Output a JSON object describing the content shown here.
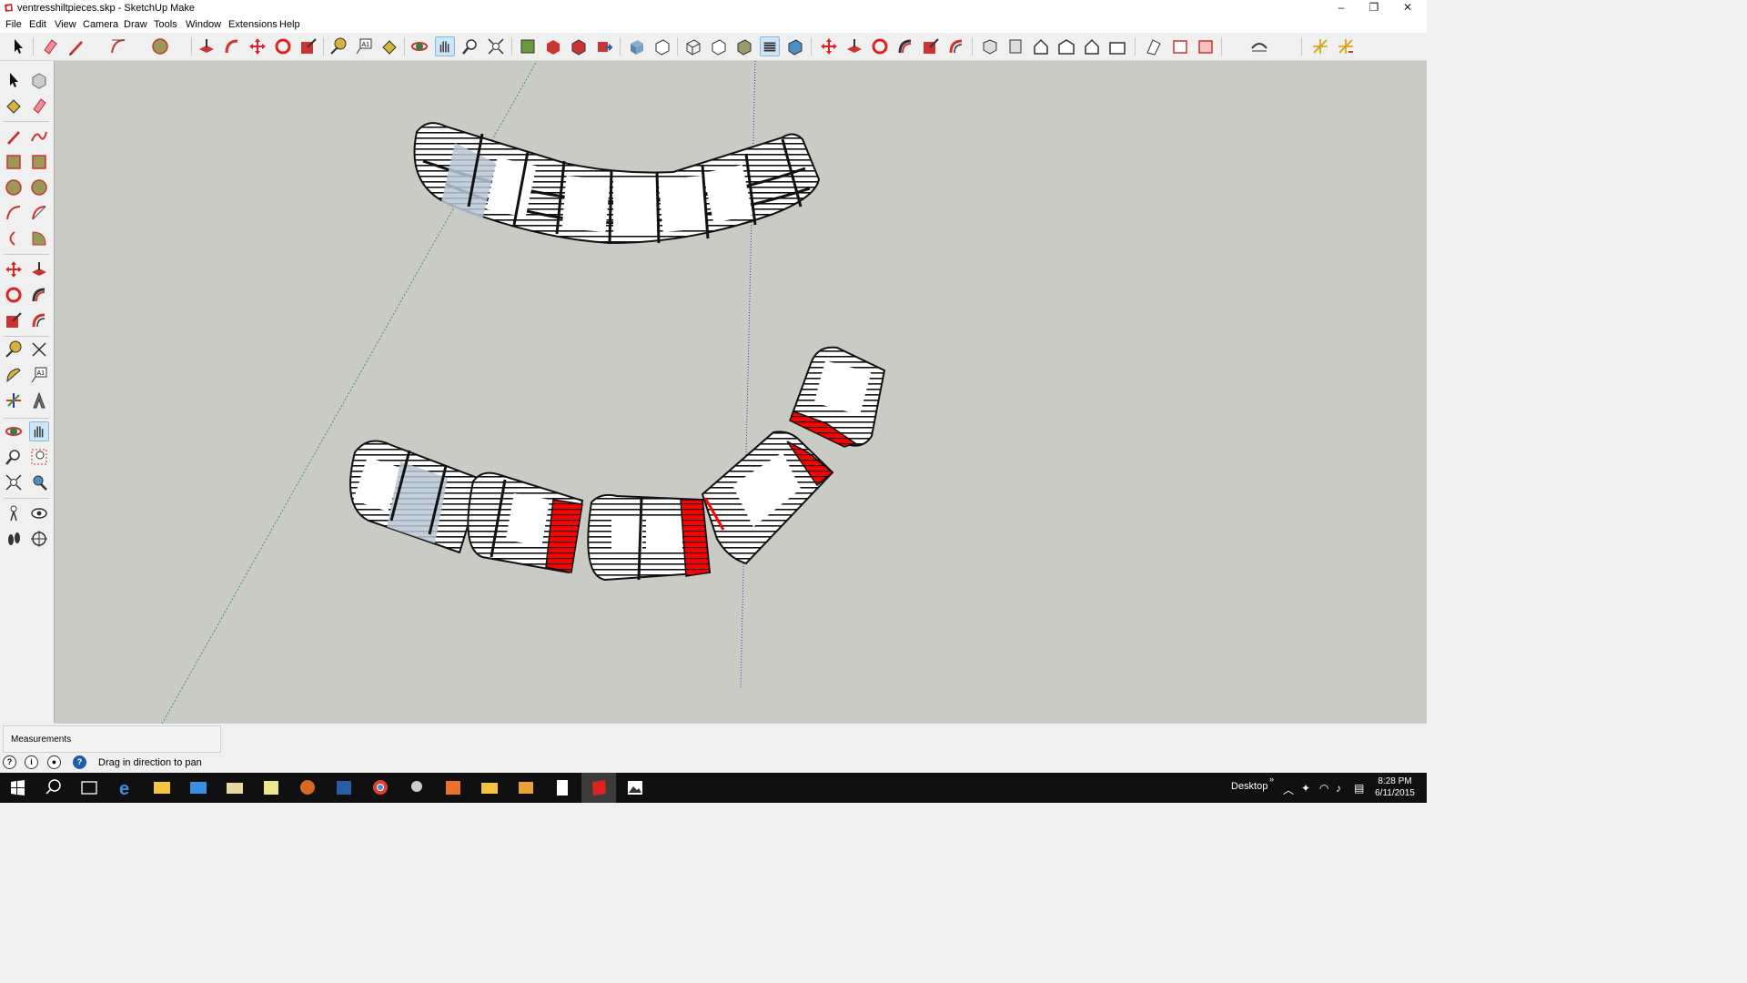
{
  "window": {
    "title": "ventresshiltpieces.skp - SketchUp Make",
    "minimize": "–",
    "restore": "❐",
    "close": "✕"
  },
  "menu": [
    "File",
    "Edit",
    "View",
    "Camera",
    "Draw",
    "Tools",
    "Window",
    "Extensions",
    "Help"
  ],
  "toolbar": {
    "icons": [
      "select-icon",
      "eraser-icon",
      "pencil-icon",
      "freehand-icon",
      "arc-icon",
      "circle-icon",
      "push-pull-icon",
      "follow-me-icon",
      "move-icon",
      "rotate-icon",
      "scale-icon",
      "tape-measure-icon",
      "text-icon",
      "paint-bucket-icon",
      "orbit-icon",
      "pan-icon",
      "zoom-icon",
      "zoom-extents-icon",
      "3d-warehouse-icon",
      "get-models-icon",
      "share-model-icon",
      "extension-warehouse-icon",
      "xray-icon",
      "back-edges-icon",
      "wireframe-icon",
      "hidden-line-icon",
      "shaded-icon",
      "shaded-textures-icon",
      "monochrome-icon",
      "move-icon",
      "push-pull-icon",
      "rotate-icon",
      "follow-me-icon",
      "scale-icon",
      "offset-icon",
      "iso-view-icon",
      "top-view-icon",
      "front-view-icon",
      "right-view-icon",
      "back-view-icon",
      "left-view-icon",
      "section-plane-icon",
      "display-section-planes-icon",
      "display-section-cuts-icon",
      "sandbox-icon",
      "sun-icon",
      "shadows-icon"
    ],
    "active": "pan-icon"
  },
  "left_tools": [
    "select-icon",
    "component-icon",
    "paint-bucket-icon",
    "eraser-icon",
    "line-icon",
    "freehand-icon",
    "rectangle-icon",
    "rotated-rectangle-icon",
    "circle-icon",
    "polygon-icon",
    "arc-icon",
    "two-point-arc-icon",
    "three-point-arc-icon",
    "pie-icon",
    "move-icon",
    "push-pull-icon",
    "rotate-icon",
    "follow-me-icon",
    "scale-icon",
    "offset-icon",
    "tape-measure-icon",
    "dimension-icon",
    "protractor-icon",
    "text-icon",
    "axes-icon",
    "3d-text-icon",
    "orbit-icon",
    "pan-icon",
    "zoom-icon",
    "zoom-window-icon",
    "zoom-extents-icon",
    "previous-view-icon",
    "position-camera-icon",
    "look-around-icon",
    "walk-icon",
    "section-plane-icon"
  ],
  "measurements_label": "Measurements",
  "status_text": "Drag in direction to pan",
  "status_icons": [
    "geo-location-icon",
    "credits-icon",
    "user-icon",
    "help-icon"
  ],
  "taskbar": {
    "apps": [
      "start-icon",
      "search-icon",
      "task-view-icon",
      "edge-icon",
      "file-explorer-icon",
      "store-icon",
      "folder-icon",
      "sticky-notes-icon",
      "basketball-icon",
      "media-icon",
      "chrome-icon",
      "user-app-icon",
      "office-icon",
      "folder-icon",
      "video-icon",
      "calculator-icon",
      "sketchup-icon",
      "photos-icon"
    ],
    "desktop_label": "Desktop",
    "time": "8:28 PM",
    "date": "6/11/2015"
  },
  "colors": {
    "viewport_bg": "#cbcbc6",
    "highlight_red": "#ff0000",
    "selection_blue": "#b9c8d6",
    "green_axis": "#3c9a3c",
    "blue_axis": "#2f2fa8"
  }
}
